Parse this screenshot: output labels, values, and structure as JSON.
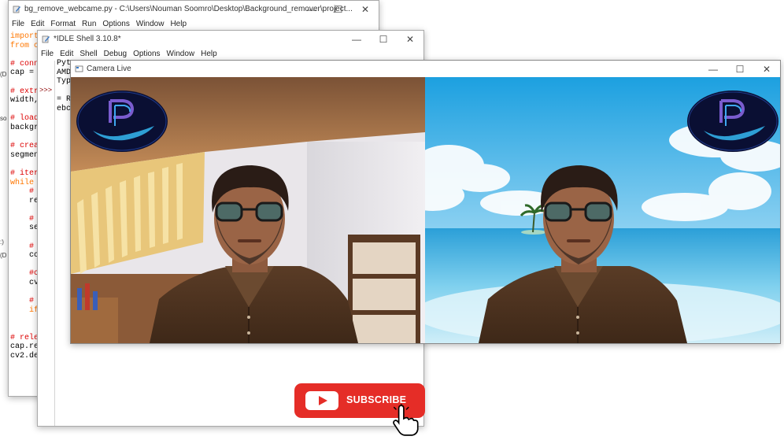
{
  "editor_window": {
    "title": "bg_remove_webcame.py - C:\\Users\\Nouman Soomro\\Desktop\\Background_remover\\project...",
    "menu": [
      "File",
      "Edit",
      "Format",
      "Run",
      "Options",
      "Window",
      "Help"
    ],
    "code_lines": [
      {
        "t": "kw",
        "s": "import"
      },
      {
        "t": "kw",
        "s": "from c"
      },
      {
        "t": "plain",
        "s": ""
      },
      {
        "t": "cmt",
        "s": "# conn"
      },
      {
        "t": "plain",
        "s": "cap ="
      },
      {
        "t": "plain",
        "s": ""
      },
      {
        "t": "cmt",
        "s": "# extr"
      },
      {
        "t": "plain",
        "s": "width,"
      },
      {
        "t": "plain",
        "s": ""
      },
      {
        "t": "cmt",
        "s": "# load"
      },
      {
        "t": "plain",
        "s": "backgr"
      },
      {
        "t": "plain",
        "s": ""
      },
      {
        "t": "cmt",
        "s": "# crea"
      },
      {
        "t": "plain",
        "s": "segmen"
      },
      {
        "t": "plain",
        "s": ""
      },
      {
        "t": "cmt",
        "s": "# iter"
      },
      {
        "t": "kw",
        "s": "while"
      },
      {
        "t": "cmt",
        "s": "    #"
      },
      {
        "t": "plain",
        "s": "    re"
      },
      {
        "t": "plain",
        "s": ""
      },
      {
        "t": "cmt",
        "s": "    #"
      },
      {
        "t": "plain",
        "s": "    se"
      },
      {
        "t": "plain",
        "s": ""
      },
      {
        "t": "cmt",
        "s": "    #"
      },
      {
        "t": "plain",
        "s": "    cc"
      },
      {
        "t": "plain",
        "s": ""
      },
      {
        "t": "cmt",
        "s": "    #c"
      },
      {
        "t": "plain",
        "s": "    cv"
      },
      {
        "t": "plain",
        "s": ""
      },
      {
        "t": "cmt",
        "s": "    #"
      },
      {
        "t": "kw",
        "s": "    if"
      },
      {
        "t": "plain",
        "s": ""
      },
      {
        "t": "plain",
        "s": ""
      },
      {
        "t": "cmt",
        "s": "# rele"
      },
      {
        "t": "plain",
        "s": "cap.re"
      },
      {
        "t": "plain",
        "s": "cv2.de"
      }
    ]
  },
  "shell_window": {
    "title": "*IDLE Shell 3.10.8*",
    "menu": [
      "File",
      "Edit",
      "Shell",
      "Debug",
      "Options",
      "Window",
      "Help"
    ],
    "output_lines": [
      "Pyt",
      "AMD",
      "Typ",
      "",
      "= R",
      "ebc"
    ],
    "prompt": ">>>"
  },
  "left_edge_fragments": [
    "(D",
    "so",
    ":)",
    "(D"
  ],
  "camera_window": {
    "title": "Camera Live",
    "controls": {
      "minimize": "—",
      "maximize": "☐",
      "close": "✕"
    }
  },
  "subscribe_button": {
    "label": "SUBSCRIBE"
  },
  "colors": {
    "youtube_red": "#e52d27",
    "idle_comment": "#dd0000",
    "idle_keyword": "#ff7700",
    "idle_prompt": "#8b0000",
    "sky_top": "#3fb3e6",
    "sea": "#39a5d8"
  }
}
